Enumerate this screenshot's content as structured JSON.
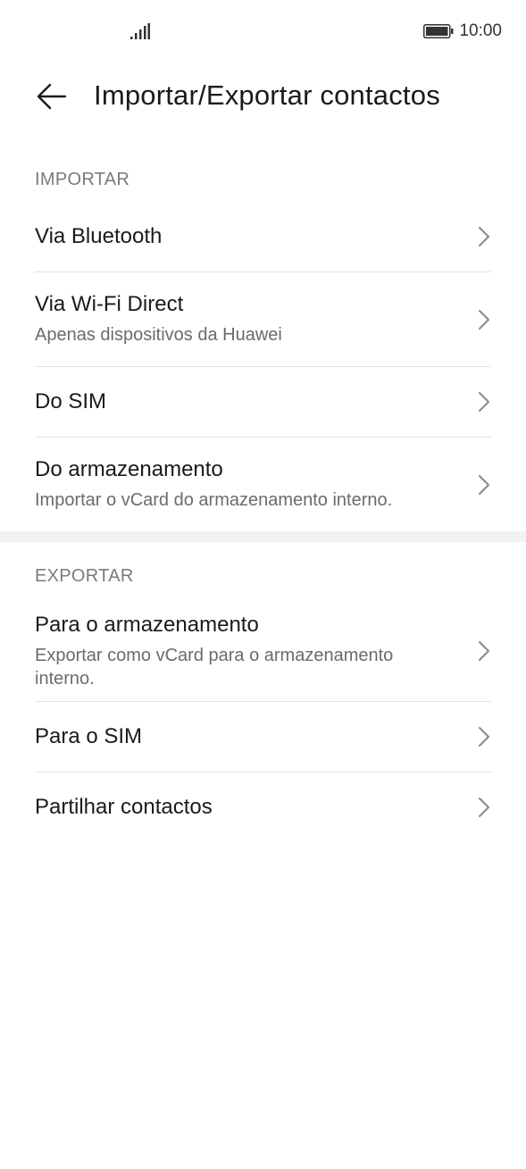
{
  "status_bar": {
    "time": "10:00",
    "signal_icon": "signal-bars-icon",
    "battery_icon": "battery-full-icon"
  },
  "header": {
    "back_icon": "arrow-left-icon",
    "title": "Importar/Exportar contactos"
  },
  "import_section": {
    "header": "IMPORTAR",
    "items": [
      {
        "title": "Via Bluetooth",
        "subtitle": ""
      },
      {
        "title": "Via Wi-Fi Direct",
        "subtitle": "Apenas dispositivos da Huawei"
      },
      {
        "title": "Do SIM",
        "subtitle": ""
      },
      {
        "title": "Do armazenamento",
        "subtitle": "Importar o vCard do armazenamento interno."
      }
    ]
  },
  "export_section": {
    "header": "EXPORTAR",
    "items": [
      {
        "title": "Para o armazenamento",
        "subtitle": "Exportar como vCard para o armazenamento interno."
      },
      {
        "title": "Para o SIM",
        "subtitle": ""
      },
      {
        "title": "Partilhar contactos",
        "subtitle": ""
      }
    ]
  },
  "colors": {
    "section_header": "#7a7a7a",
    "divider": "#e2e2e2",
    "section_gap": "#f2f2f2"
  }
}
